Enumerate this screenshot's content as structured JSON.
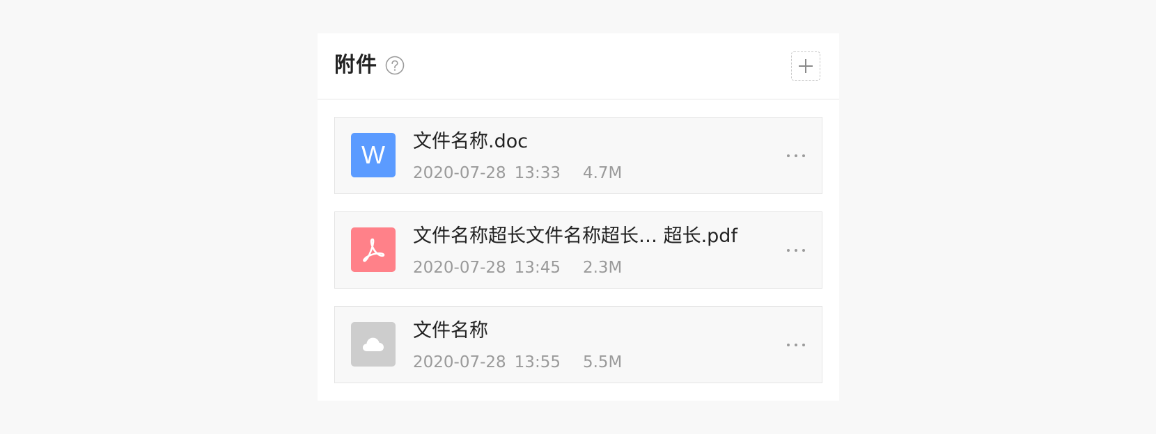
{
  "panel": {
    "title": "附件",
    "help_icon": "question-circle-icon",
    "add_icon": "plus-icon"
  },
  "files": [
    {
      "icon": "word-file-icon",
      "icon_letter": "W",
      "icon_color": "#5b9bff",
      "name": "文件名称.doc",
      "date": "2020-07-28",
      "time": "13:33",
      "size": "4.7M",
      "more_icon": "more-horizontal-icon"
    },
    {
      "icon": "pdf-file-icon",
      "icon_color": "#ff8189",
      "name": "文件名称超长文件名称超长… 超长.pdf",
      "date": "2020-07-28",
      "time": "13:45",
      "size": "2.3M",
      "more_icon": "more-horizontal-icon"
    },
    {
      "icon": "cloud-file-icon",
      "icon_color": "#cdcdcd",
      "name": "文件名称",
      "date": "2020-07-28",
      "time": "13:55",
      "size": "5.5M",
      "more_icon": "more-horizontal-icon"
    }
  ]
}
